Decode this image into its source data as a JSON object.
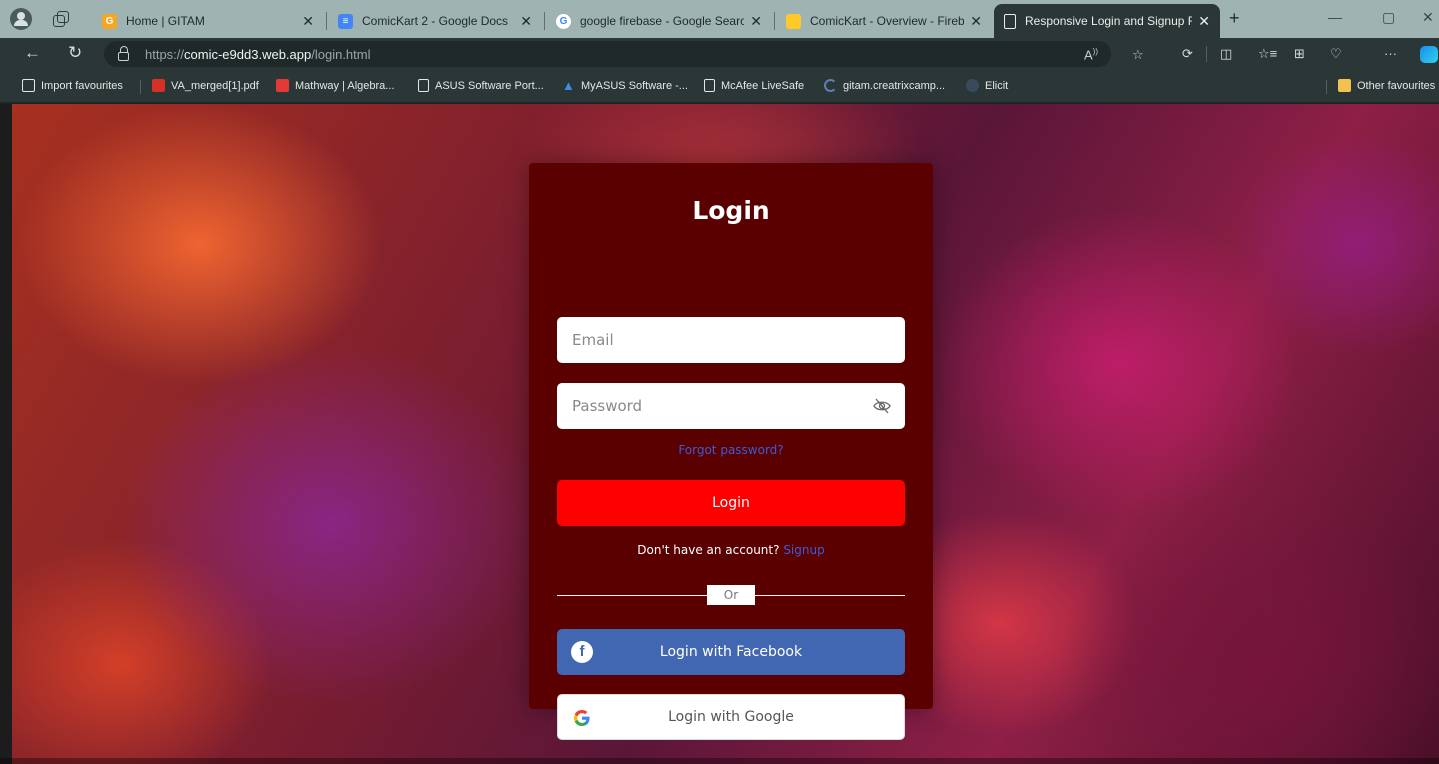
{
  "browser": {
    "tabs": [
      {
        "title": "Home | GITAM",
        "favicon": "gitam-icon",
        "color": "#f5a623"
      },
      {
        "title": "ComicKart 2 - Google Docs",
        "favicon": "google-docs-icon",
        "color": "#4285f4"
      },
      {
        "title": "google firebase - Google Search",
        "favicon": "google-icon",
        "color": "#ffffff"
      },
      {
        "title": "ComicKart - Overview - Firebase",
        "favicon": "firebase-icon",
        "color": "#ffca28"
      },
      {
        "title": "Responsive Login and Signup For",
        "favicon": "page-icon",
        "color": "#e8eded",
        "active": true
      }
    ],
    "url_prefix": "https://",
    "url_host": "comic-e9dd3.web.app",
    "url_path": "/login.html",
    "favourites": [
      {
        "label": "Import favourites",
        "icon": "import-icon"
      },
      {
        "label": "VA_merged[1].pdf",
        "icon": "pdf-icon"
      },
      {
        "label": "Mathway | Algebra...",
        "icon": "mathway-icon"
      },
      {
        "label": "ASUS Software Port...",
        "icon": "page-icon"
      },
      {
        "label": "MyASUS Software -...",
        "icon": "myasus-icon"
      },
      {
        "label": "McAfee LiveSafe",
        "icon": "page-icon"
      },
      {
        "label": "gitam.creatrixcamp...",
        "icon": "loading-icon"
      },
      {
        "label": "Elicit",
        "icon": "elicit-icon"
      },
      {
        "label": "Other favourites",
        "icon": "folder-icon"
      }
    ]
  },
  "login": {
    "title": "Login",
    "email_placeholder": "Email",
    "password_placeholder": "Password",
    "forgot_password": "Forgot password?",
    "login_button": "Login",
    "no_account_text": "Don't have an account?",
    "signup_link": "Signup",
    "or_text": "Or",
    "facebook_button": "Login with Facebook",
    "google_button": "Login with Google"
  },
  "colors": {
    "card_bg": "#5b0000",
    "login_button": "#ff0000",
    "facebook_button": "#4267b2",
    "link": "#3d5bd6"
  }
}
